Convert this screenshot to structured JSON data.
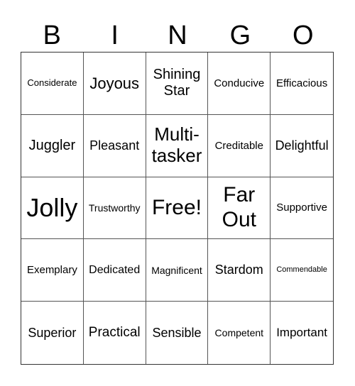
{
  "title_letters": [
    "B",
    "I",
    "N",
    "G",
    "O"
  ],
  "cells": [
    [
      "Considerate",
      "Joyous",
      "Shining Star",
      "Conducive",
      "Efficacious"
    ],
    [
      "Juggler",
      "Pleasant",
      "Multi-tasker",
      "Creditable",
      "Delightful"
    ],
    [
      "Jolly",
      "Trustworthy",
      "Free!",
      "Far Out",
      "Supportive"
    ],
    [
      "Exemplary",
      "Dedicated",
      "Magnificent",
      "Stardom",
      "Commendable"
    ],
    [
      "Superior",
      "Practical",
      "Sensible",
      "Competent",
      "Important"
    ]
  ]
}
